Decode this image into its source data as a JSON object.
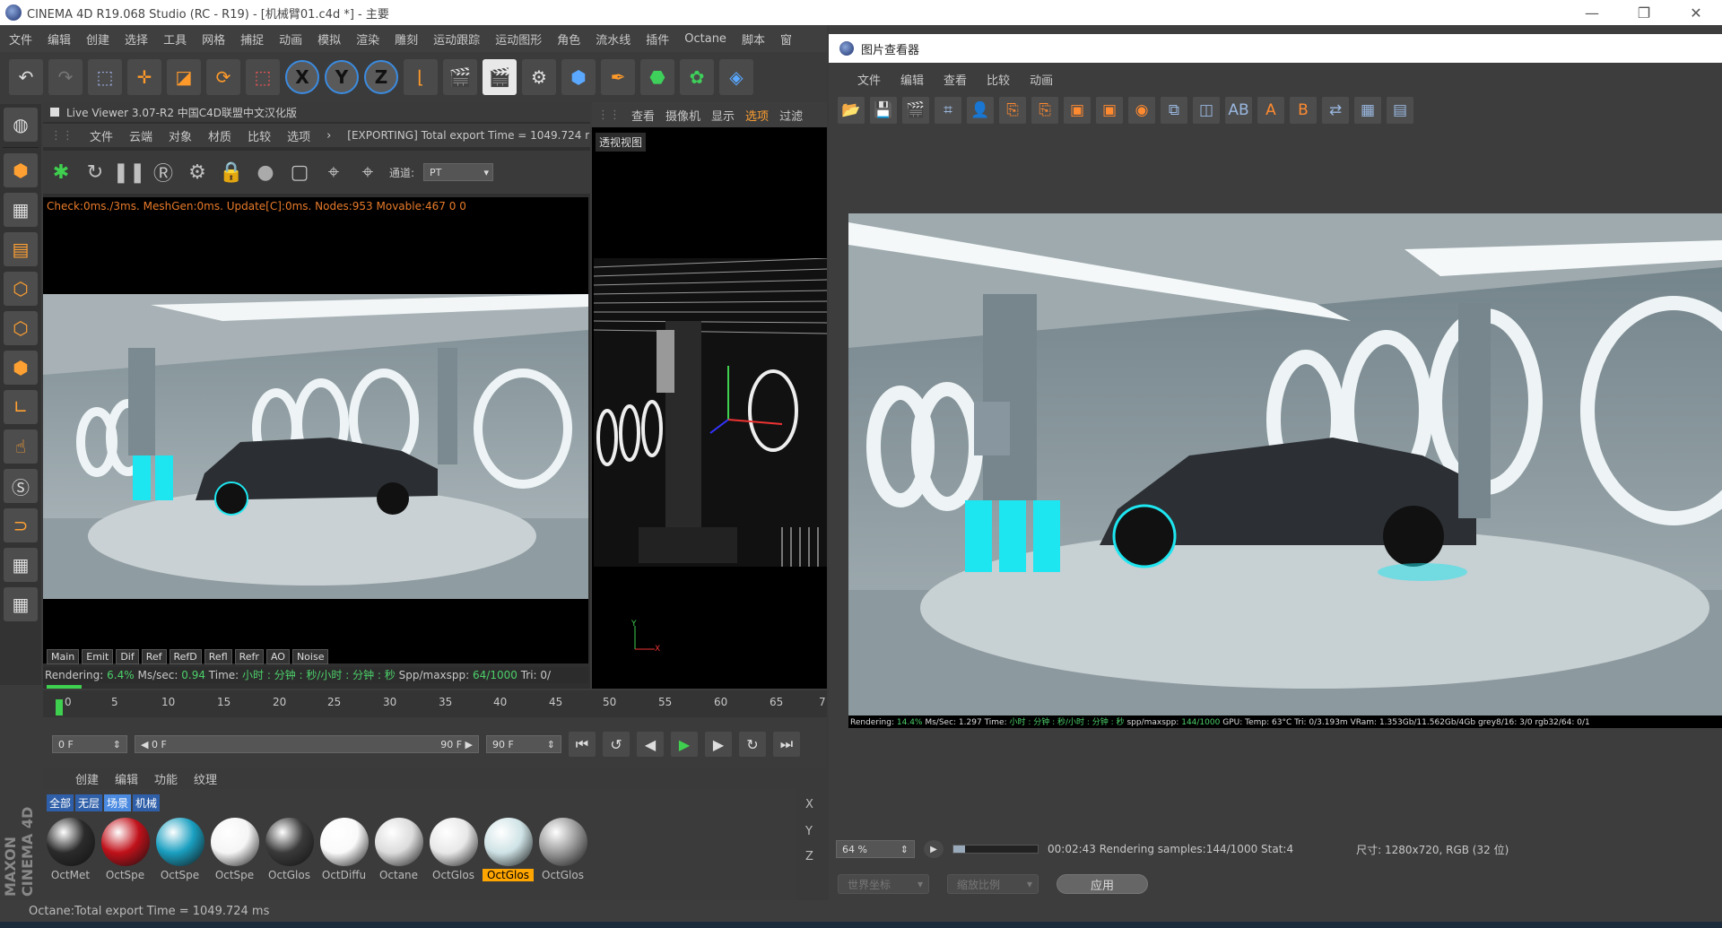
{
  "window": {
    "title": "CINEMA 4D R19.068 Studio (RC - R19) - [机械臂01.c4d *] - 主要",
    "controls": [
      "—",
      "❐",
      "✕"
    ]
  },
  "menubar": [
    "文件",
    "编辑",
    "创建",
    "选择",
    "工具",
    "网格",
    "捕捉",
    "动画",
    "模拟",
    "渲染",
    "雕刻",
    "运动跟踪",
    "运动图形",
    "角色",
    "流水线",
    "插件",
    "Octane",
    "脚本",
    "窗"
  ],
  "live_viewer": {
    "header": "Live Viewer 3.07-R2 中国C4D联盟中文汉化版",
    "menu": [
      "文件",
      "云端",
      "对象",
      "材质",
      "比较",
      "选项"
    ],
    "export_text": "[EXPORTING] Total export Time = 1049.724 r",
    "channel_label": "通道:",
    "channel_value": "PT",
    "check_line": "Check:0ms./3ms. MeshGen:0ms. Update[C]:0ms. Nodes:953 Movable:467  0 0",
    "pass_tabs": [
      "Main",
      "Emit",
      "Dif",
      "Ref",
      "RefD",
      "Refl",
      "Refr",
      "AO",
      "Noise"
    ],
    "status": {
      "rendering_label": "Rendering:",
      "rendering_value": "6.4%",
      "mssec_label": "Ms/sec:",
      "mssec_value": "0.94",
      "time_label": "Time:",
      "time_value": "小时 : 分钟 : 秒/小时 : 分钟 : 秒",
      "spp_label": "Spp/maxspp:",
      "spp_value": "64/1000",
      "tri_label": "Tri: 0/"
    },
    "progress": 0.064
  },
  "viewport": {
    "menu": [
      "查看",
      "摄像机",
      "显示",
      "选项",
      "过滤"
    ],
    "label": "透视视图"
  },
  "timeline": {
    "ticks": [
      "0",
      "5",
      "10",
      "15",
      "20",
      "25",
      "30",
      "35",
      "40",
      "45",
      "50",
      "55",
      "60",
      "65",
      "7"
    ],
    "start_field": "0 F",
    "range_start": "◀ 0 F",
    "range_end": "90 F ▶",
    "end_field": "90 F"
  },
  "material_manager": {
    "menu": [
      "创建",
      "编辑",
      "功能",
      "纹理"
    ],
    "tabs": [
      "全部",
      "无层",
      "场景",
      "机械"
    ],
    "materials": [
      {
        "name": "OctMet",
        "color": "#2b2b2b"
      },
      {
        "name": "OctSpe",
        "color": "#c0111a"
      },
      {
        "name": "OctSpe",
        "color": "#1a9fc0"
      },
      {
        "name": "OctSpe",
        "color": "#f5f5f5"
      },
      {
        "name": "OctGlos",
        "color": "#3a3a3a"
      },
      {
        "name": "OctDiffu",
        "color": "#fafafa"
      },
      {
        "name": "Octane",
        "color": "#dcdcdc"
      },
      {
        "name": "OctGlos",
        "color": "#e8e8e8"
      },
      {
        "name": "OctGlos",
        "color": "#cfe3e6",
        "selected": true
      },
      {
        "name": "OctGlos",
        "color": "#9a9a9a"
      }
    ],
    "maxon_text": "MAXON CINEMA 4D"
  },
  "coord_labels": [
    "X",
    "Y",
    "Z"
  ],
  "status_bar": "Octane:Total export Time = 1049.724 ms",
  "picture_viewer": {
    "title": "图片查看器",
    "menu": [
      "文件",
      "编辑",
      "查看",
      "比较",
      "动画"
    ],
    "render_stats": {
      "rendering_label": "Rendering:",
      "rendering_value": "14.4%",
      "mssec": "Ms/Sec: 1.297",
      "time": "Time:",
      "time_value": "小时 : 分钟 : 秒/小时 : 分钟 : 秒",
      "spp": "spp/maxspp:",
      "spp_value": "144/1000",
      "gpu": "GPU:",
      "temp": "Temp: 63°C",
      "tri": "Tri: 0/3.193m",
      "vram": "VRam: 1.353Gb/11.562Gb/4Gb",
      "grey": "grey8/16: 3/0",
      "rgb": "rgb32/64: 0/1"
    },
    "zoom": "64 %",
    "render_status": "00:02:43 Rendering samples:144/1000 Stat:4",
    "size": "尺寸: 1280x720, RGB (32 位)",
    "progress": 0.14,
    "dropdown1": "世界坐标",
    "dropdown2": "缩放比例",
    "apply_button": "应用"
  },
  "colors": {
    "accent_green": "#3fd04f",
    "accent_orange": "#ff9a2a",
    "cyan_glow": "#1ee6f0"
  }
}
